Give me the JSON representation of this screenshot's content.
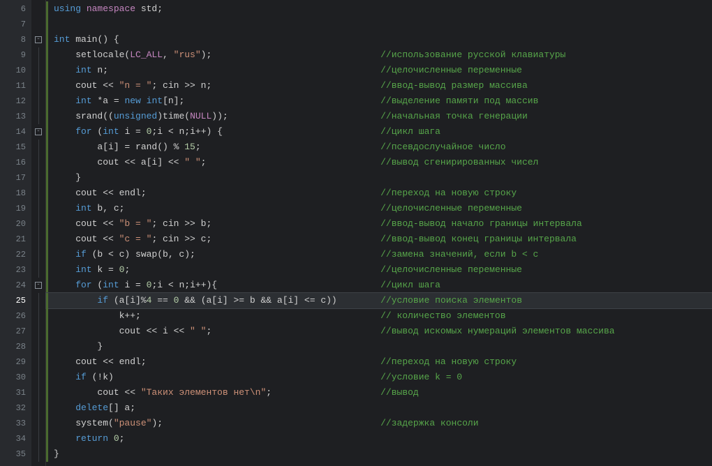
{
  "first_line": 6,
  "active_line": 25,
  "lines": [
    {
      "n": 6,
      "fold": "",
      "seg": [
        [
          "kw",
          "using "
        ],
        [
          "ns",
          "namespace "
        ],
        [
          "id",
          "std"
        ],
        [
          "op",
          ";"
        ]
      ]
    },
    {
      "n": 7,
      "fold": "",
      "seg": []
    },
    {
      "n": 8,
      "fold": "box",
      "seg": [
        [
          "kw",
          "int "
        ],
        [
          "func",
          "main"
        ],
        [
          "op",
          "() {"
        ]
      ]
    },
    {
      "n": 9,
      "fold": "line",
      "seg": [
        [
          "id",
          "    setlocale("
        ],
        [
          "const",
          "LC_ALL"
        ],
        [
          "op",
          ", "
        ],
        [
          "str",
          "\"rus\""
        ],
        [
          "op",
          ");"
        ]
      ],
      "comment": "//использование русской клавиатуры"
    },
    {
      "n": 10,
      "fold": "line",
      "seg": [
        [
          "kw",
          "    int "
        ],
        [
          "id",
          "n"
        ],
        [
          "op",
          ";"
        ]
      ],
      "comment": "//целочисленные переменные"
    },
    {
      "n": 11,
      "fold": "line",
      "seg": [
        [
          "id",
          "    cout "
        ],
        [
          "op",
          "<< "
        ],
        [
          "str",
          "\"n = \""
        ],
        [
          "op",
          "; cin "
        ],
        [
          "op",
          ">> n;"
        ]
      ],
      "comment": "//ввод-вывод размер массива"
    },
    {
      "n": 12,
      "fold": "line",
      "seg": [
        [
          "kw",
          "    int "
        ],
        [
          "op",
          "*a = "
        ],
        [
          "kw",
          "new "
        ],
        [
          "kw",
          "int"
        ],
        [
          "op",
          "[n];"
        ]
      ],
      "comment": "//выделение памяти под массив"
    },
    {
      "n": 13,
      "fold": "line",
      "seg": [
        [
          "id",
          "    srand"
        ],
        [
          "op",
          "(("
        ],
        [
          "kw",
          "unsigned"
        ],
        [
          "op",
          ")time("
        ],
        [
          "const",
          "NULL"
        ],
        [
          "op",
          "));"
        ]
      ],
      "comment": "//начальная точка генерации"
    },
    {
      "n": 14,
      "fold": "box",
      "seg": [
        [
          "kw",
          "    for "
        ],
        [
          "op",
          "("
        ],
        [
          "kw",
          "int "
        ],
        [
          "id",
          "i = "
        ],
        [
          "num",
          "0"
        ],
        [
          "op",
          ";i < n;i++) {"
        ]
      ],
      "comment": "//цикл шага"
    },
    {
      "n": 15,
      "fold": "line",
      "seg": [
        [
          "id",
          "        a[i] = rand() % "
        ],
        [
          "num",
          "15"
        ],
        [
          "op",
          ";"
        ]
      ],
      "comment": "//псевдослучайное число"
    },
    {
      "n": 16,
      "fold": "line",
      "seg": [
        [
          "id",
          "        cout "
        ],
        [
          "op",
          "<< a[i] << "
        ],
        [
          "str",
          "\" \""
        ],
        [
          "op",
          ";"
        ]
      ],
      "comment": "//вывод сгенирированных чисел"
    },
    {
      "n": 17,
      "fold": "line",
      "seg": [
        [
          "op",
          "    }"
        ]
      ]
    },
    {
      "n": 18,
      "fold": "line",
      "seg": [
        [
          "id",
          "    cout "
        ],
        [
          "op",
          "<< endl;"
        ]
      ],
      "comment": "//переход на новую строку"
    },
    {
      "n": 19,
      "fold": "line",
      "seg": [
        [
          "kw",
          "    int "
        ],
        [
          "id",
          "b, c"
        ],
        [
          "op",
          ";"
        ]
      ],
      "comment": "//целочисленные переменные"
    },
    {
      "n": 20,
      "fold": "line",
      "seg": [
        [
          "id",
          "    cout "
        ],
        [
          "op",
          "<< "
        ],
        [
          "str",
          "\"b = \""
        ],
        [
          "op",
          "; cin "
        ],
        [
          "op",
          ">> b;"
        ]
      ],
      "comment": "//ввод-вывод начало границы интервала"
    },
    {
      "n": 21,
      "fold": "line",
      "seg": [
        [
          "id",
          "    cout "
        ],
        [
          "op",
          "<< "
        ],
        [
          "str",
          "\"c = \""
        ],
        [
          "op",
          "; cin "
        ],
        [
          "op",
          ">> c;"
        ]
      ],
      "comment": "//ввод-вывод конец границы интервала"
    },
    {
      "n": 22,
      "fold": "line",
      "seg": [
        [
          "kw",
          "    if "
        ],
        [
          "op",
          "(b < c) swap(b, c);"
        ]
      ],
      "comment": "//замена значений, если b < c"
    },
    {
      "n": 23,
      "fold": "line",
      "seg": [
        [
          "kw",
          "    int "
        ],
        [
          "id",
          "k = "
        ],
        [
          "num",
          "0"
        ],
        [
          "op",
          ";"
        ]
      ],
      "comment": "//целочисленные переменные"
    },
    {
      "n": 24,
      "fold": "box",
      "seg": [
        [
          "kw",
          "    for "
        ],
        [
          "op",
          "("
        ],
        [
          "kw",
          "int "
        ],
        [
          "id",
          "i = "
        ],
        [
          "num",
          "0"
        ],
        [
          "op",
          ";i < n;i++){"
        ]
      ],
      "comment": "//цикл шага"
    },
    {
      "n": 25,
      "fold": "line",
      "seg": [
        [
          "kw",
          "        if "
        ],
        [
          "op",
          "(a[i]%"
        ],
        [
          "num",
          "4"
        ],
        [
          "op",
          " == "
        ],
        [
          "num",
          "0"
        ],
        [
          "op",
          " && (a[i] >= b && a[i] <= c))"
        ]
      ],
      "comment": "//условие поиска элементов",
      "hl": true
    },
    {
      "n": 26,
      "fold": "line",
      "seg": [
        [
          "id",
          "            k++;"
        ]
      ],
      "comment": "// количество элементов"
    },
    {
      "n": 27,
      "fold": "line",
      "seg": [
        [
          "id",
          "            cout "
        ],
        [
          "op",
          "<< i << "
        ],
        [
          "str",
          "\" \""
        ],
        [
          "op",
          ";"
        ]
      ],
      "comment": "//вывод искомых нумераций элементов массива"
    },
    {
      "n": 28,
      "fold": "line",
      "seg": [
        [
          "op",
          "        }"
        ]
      ]
    },
    {
      "n": 29,
      "fold": "line",
      "seg": [
        [
          "id",
          "    cout "
        ],
        [
          "op",
          "<< endl;"
        ]
      ],
      "comment": "//переход на новую строку"
    },
    {
      "n": 30,
      "fold": "line",
      "seg": [
        [
          "kw",
          "    if "
        ],
        [
          "op",
          "(!k)"
        ]
      ],
      "comment": "//условие k = 0"
    },
    {
      "n": 31,
      "fold": "line",
      "seg": [
        [
          "id",
          "        cout "
        ],
        [
          "op",
          "<< "
        ],
        [
          "str",
          "\"Таких элементов нет\\n\""
        ],
        [
          "op",
          ";"
        ]
      ],
      "comment": "//вывод"
    },
    {
      "n": 32,
      "fold": "line",
      "seg": [
        [
          "kw",
          "    delete"
        ],
        [
          "op",
          "[] a;"
        ]
      ]
    },
    {
      "n": 33,
      "fold": "line",
      "seg": [
        [
          "id",
          "    system"
        ],
        [
          "op",
          "("
        ],
        [
          "str",
          "\"pause\""
        ],
        [
          "op",
          ");"
        ]
      ],
      "comment": "//задержка консоли"
    },
    {
      "n": 34,
      "fold": "line",
      "seg": [
        [
          "kw",
          "    return "
        ],
        [
          "num",
          "0"
        ],
        [
          "op",
          ";"
        ]
      ]
    },
    {
      "n": 35,
      "fold": "line",
      "seg": [
        [
          "op",
          "}"
        ]
      ]
    }
  ],
  "comment_col": 60
}
